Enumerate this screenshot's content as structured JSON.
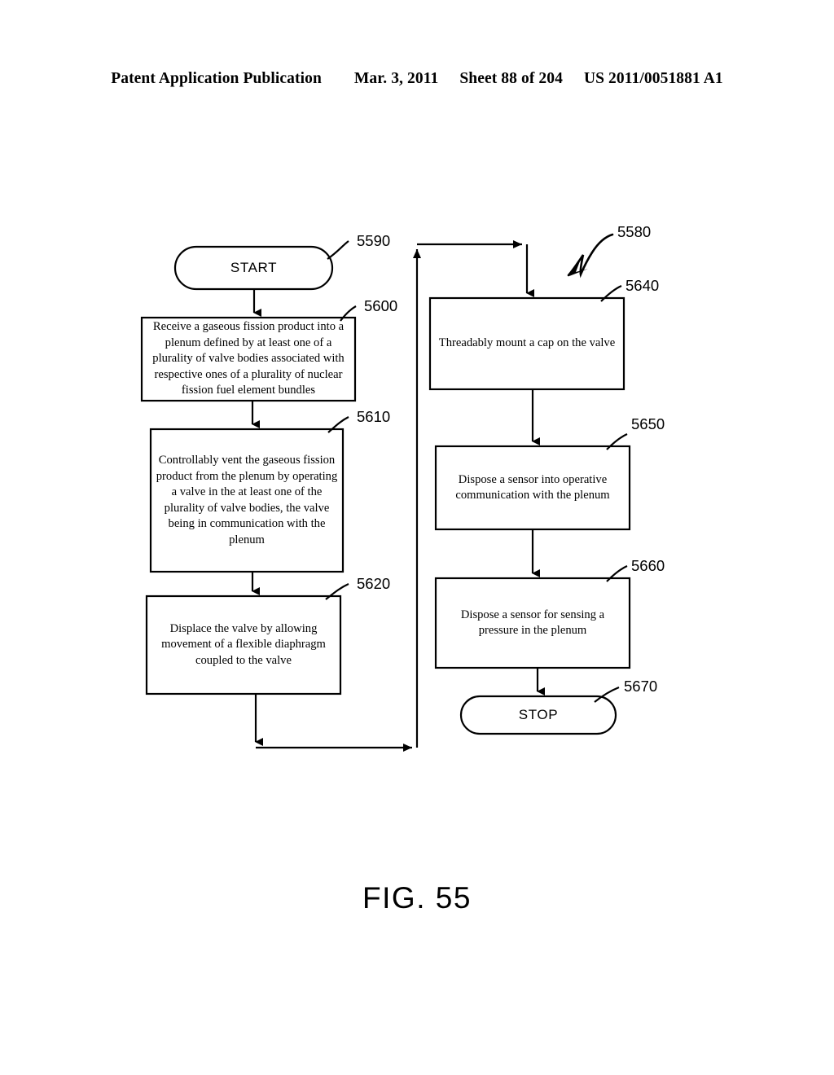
{
  "header": {
    "publication": "Patent Application Publication",
    "date": "Mar. 3, 2011",
    "sheet": "Sheet 88 of 204",
    "patent_number": "US 2011/0051881 A1"
  },
  "figure": {
    "caption": "FIG. 55",
    "diagram_ref": "5580"
  },
  "nodes": {
    "start": {
      "ref": "5590",
      "label": "START",
      "shape": "terminal"
    },
    "step_5600": {
      "ref": "5600",
      "label": "Receive a gaseous fission product into a plenum defined by at least one of a plurality of valve bodies associated with respective ones of a plurality of nuclear fission fuel element bundles",
      "shape": "process"
    },
    "step_5610": {
      "ref": "5610",
      "label": "Controllably vent the gaseous fission product from the plenum by operating a valve in the at least one of the plurality of valve bodies, the valve being in communication with the plenum",
      "shape": "process"
    },
    "step_5620": {
      "ref": "5620",
      "label": "Displace the valve by allowing movement of a flexible diaphragm coupled to the valve",
      "shape": "process"
    },
    "step_5640": {
      "ref": "5640",
      "label": "Threadably mount a cap on the valve",
      "shape": "process"
    },
    "step_5650": {
      "ref": "5650",
      "label": "Dispose a sensor into operative communication with the plenum",
      "shape": "process"
    },
    "step_5660": {
      "ref": "5660",
      "label": "Dispose a sensor for sensing a pressure in the plenum",
      "shape": "process"
    },
    "stop": {
      "ref": "5670",
      "label": "STOP",
      "shape": "terminal"
    }
  },
  "colors": {
    "ink": "#000000",
    "paper": "#ffffff"
  }
}
